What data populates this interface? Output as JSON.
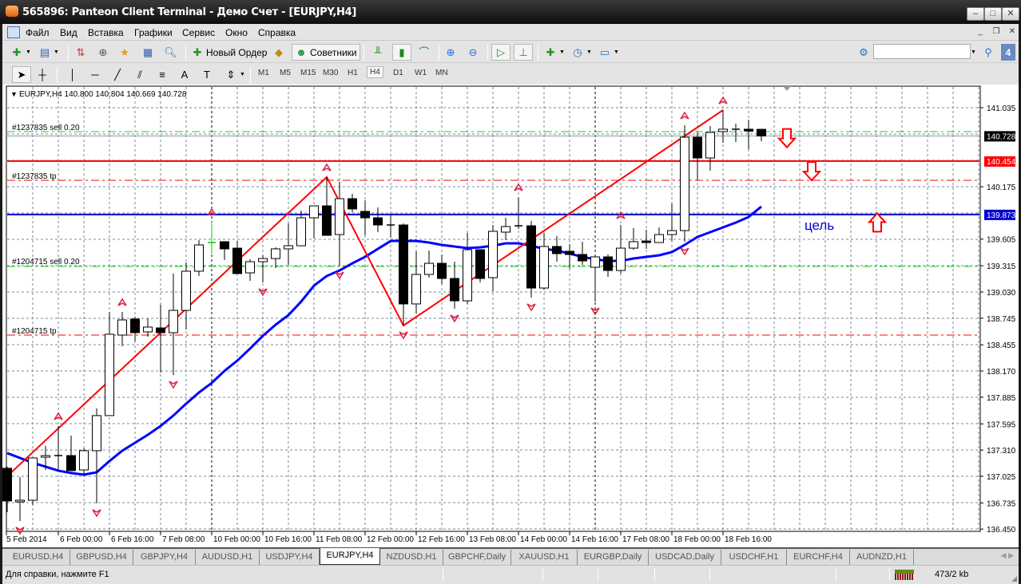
{
  "window": {
    "title": "565896: Panteon Client Terminal - Демо Счет - [EURJPY,H4]"
  },
  "menu": [
    "Файл",
    "Вид",
    "Вставка",
    "Графики",
    "Сервис",
    "Окно",
    "Справка"
  ],
  "toolbar": {
    "new_order_label": "Новый Ордер",
    "experts_label": "Советники",
    "search_value": "",
    "notification_count": "4",
    "timeframes": [
      "M1",
      "M5",
      "M15",
      "M30",
      "H1",
      "H4",
      "D1",
      "W1",
      "MN"
    ],
    "active_timeframe": "H4"
  },
  "chart": {
    "info": "EURJPY,H4  140.800 140.804 140.669 140.728",
    "order_labels": [
      "#1237835 sell 0.20",
      "#1237835 tp",
      "#1204715 sell 0.20",
      "#1204715 tp"
    ],
    "annotation": "цель",
    "price_tags": [
      {
        "value": "140.728",
        "bg": "#000000"
      },
      {
        "value": "140.454",
        "bg": "#ff0000"
      },
      {
        "value": "139.873",
        "bg": "#0000cc"
      }
    ]
  },
  "chart_data": {
    "type": "candlestick",
    "symbol": "EURJPY",
    "timeframe": "H4",
    "ylim": [
      136.435,
      141.252
    ],
    "grid": true,
    "price_axis_labels": [
      "141.035",
      "140.175",
      "139.605",
      "139.315",
      "139.030",
      "138.745",
      "138.455",
      "138.170",
      "137.885",
      "137.595",
      "137.310",
      "137.025",
      "136.735",
      "136.450"
    ],
    "time_axis_labels": [
      {
        "bar": 0,
        "text": "5 Feb 2014"
      },
      {
        "bar": 4,
        "text": "6 Feb 00:00"
      },
      {
        "bar": 8,
        "text": "6 Feb 16:00"
      },
      {
        "bar": 12,
        "text": "7 Feb 08:00"
      },
      {
        "bar": 16,
        "text": "10 Feb 00:00"
      },
      {
        "bar": 20,
        "text": "10 Feb 16:00"
      },
      {
        "bar": 24,
        "text": "11 Feb 08:00"
      },
      {
        "bar": 28,
        "text": "12 Feb 00:00"
      },
      {
        "bar": 32,
        "text": "12 Feb 16:00"
      },
      {
        "bar": 36,
        "text": "13 Feb 08:00"
      },
      {
        "bar": 40,
        "text": "14 Feb 00:00"
      },
      {
        "bar": 44,
        "text": "14 Feb 16:00"
      },
      {
        "bar": 48,
        "text": "17 Feb 08:00"
      },
      {
        "bar": 52,
        "text": "18 Feb 00:00"
      },
      {
        "bar": 56,
        "text": "18 Feb 16:00"
      }
    ],
    "ohlc": [
      [
        137.112,
        137.129,
        136.634,
        136.756
      ],
      [
        136.756,
        137.016,
        136.539,
        136.764
      ],
      [
        136.764,
        137.224,
        136.712,
        137.224
      ],
      [
        137.233,
        137.355,
        137.094,
        137.25
      ],
      [
        137.25,
        137.572,
        137.086,
        137.25
      ],
      [
        137.25,
        137.467,
        137.086,
        137.086
      ],
      [
        137.094,
        137.329,
        137.042,
        137.303
      ],
      [
        137.303,
        137.763,
        136.73,
        137.685
      ],
      [
        137.685,
        138.813,
        137.685,
        138.57
      ],
      [
        138.561,
        138.813,
        138.44,
        138.726
      ],
      [
        138.735,
        138.761,
        138.492,
        138.587
      ],
      [
        138.596,
        138.743,
        138.544,
        138.648
      ],
      [
        138.639,
        138.891,
        138.153,
        138.587
      ],
      [
        138.587,
        139.23,
        138.127,
        138.83
      ],
      [
        138.83,
        139.351,
        138.622,
        139.256
      ],
      [
        139.256,
        139.594,
        139.204,
        139.542
      ],
      [
        139.568,
        139.794,
        139.447,
        139.568
      ],
      [
        139.577,
        139.577,
        139.377,
        139.499
      ],
      [
        139.507,
        139.585,
        139.23,
        139.23
      ],
      [
        139.238,
        139.386,
        139.151,
        139.36
      ],
      [
        139.36,
        139.429,
        139.134,
        139.394
      ],
      [
        139.394,
        139.516,
        139.29,
        139.499
      ],
      [
        139.499,
        139.776,
        139.325,
        139.533
      ],
      [
        139.533,
        139.915,
        139.533,
        139.837
      ],
      [
        139.837,
        139.967,
        139.611,
        139.967
      ],
      [
        139.967,
        140.28,
        139.646,
        139.646
      ],
      [
        139.655,
        140.228,
        139.316,
        140.045
      ],
      [
        140.045,
        140.098,
        139.898,
        139.933
      ],
      [
        139.907,
        140.028,
        139.646,
        139.837
      ],
      [
        139.837,
        139.95,
        139.681,
        139.759
      ],
      [
        139.759,
        139.872,
        139.62,
        139.759
      ],
      [
        139.759,
        139.776,
        138.665,
        138.9
      ],
      [
        138.9,
        139.473,
        138.796,
        139.221
      ],
      [
        139.221,
        139.481,
        139.186,
        139.342
      ],
      [
        139.342,
        139.438,
        139.117,
        139.177
      ],
      [
        139.177,
        139.36,
        138.848,
        138.934
      ],
      [
        138.934,
        139.672,
        138.9,
        139.49
      ],
      [
        139.49,
        139.49,
        139.134,
        139.177
      ],
      [
        139.186,
        139.759,
        139.039,
        139.69
      ],
      [
        139.681,
        139.837,
        139.594,
        139.742
      ],
      [
        139.75,
        140.063,
        139.716,
        139.75
      ],
      [
        139.75,
        139.802,
        138.969,
        139.073
      ],
      [
        139.073,
        139.672,
        139.056,
        139.525
      ],
      [
        139.525,
        139.638,
        139.36,
        139.447
      ],
      [
        139.473,
        139.551,
        139.282,
        139.438
      ],
      [
        139.438,
        139.577,
        139.325,
        139.368
      ],
      [
        139.299,
        139.438,
        138.926,
        139.412
      ],
      [
        139.412,
        139.438,
        139.195,
        139.264
      ],
      [
        139.264,
        139.759,
        139.23,
        139.507
      ],
      [
        139.507,
        139.724,
        139.49,
        139.577
      ],
      [
        139.585,
        139.707,
        139.499,
        139.568
      ],
      [
        139.568,
        139.733,
        139.568,
        139.655
      ],
      [
        139.655,
        139.993,
        139.585,
        139.698
      ],
      [
        139.698,
        140.844,
        139.577,
        140.714
      ],
      [
        140.714,
        140.766,
        140.245,
        140.488
      ],
      [
        140.488,
        140.835,
        140.349,
        140.766
      ],
      [
        140.775,
        141.009,
        140.653,
        140.801
      ],
      [
        140.801,
        140.861,
        140.662,
        140.801
      ],
      [
        140.801,
        140.905,
        140.584,
        140.783
      ],
      [
        140.8,
        140.804,
        140.669,
        140.728
      ]
    ],
    "moving_average": [
      137.277,
      137.224,
      137.172,
      137.129,
      137.086,
      137.06,
      137.042,
      137.068,
      137.19,
      137.303,
      137.389,
      137.476,
      137.572,
      137.685,
      137.815,
      137.936,
      138.04,
      138.171,
      138.283,
      138.414,
      138.553,
      138.674,
      138.778,
      138.926,
      139.099,
      139.204,
      139.264,
      139.342,
      139.412,
      139.499,
      139.585,
      139.585,
      139.585,
      139.568,
      139.542,
      139.525,
      139.507,
      139.516,
      139.533,
      139.559,
      139.559,
      139.533,
      139.499,
      139.481,
      139.447,
      139.412,
      139.386,
      139.368,
      139.368,
      139.394,
      139.412,
      139.429,
      139.464,
      139.542,
      139.629,
      139.681,
      139.733,
      139.785,
      139.846,
      139.959
    ],
    "zigzag": [
      {
        "bar": 0,
        "price": 137.025
      },
      {
        "bar": 25,
        "price": 140.28
      },
      {
        "bar": 31,
        "price": 138.665
      },
      {
        "bar": 56,
        "price": 141.009
      }
    ],
    "fractals_up": [
      4,
      9,
      16,
      25,
      40,
      48,
      53,
      56
    ],
    "fractals_down": [
      1,
      7,
      13,
      20,
      26,
      31,
      35,
      41,
      46,
      53
    ],
    "horizontal_lines": [
      {
        "price": 140.775,
        "style": "dashdot",
        "color": "#22cc22",
        "label": "#1237835 sell 0.20"
      },
      {
        "price": 140.728,
        "style": "solid",
        "color": "#8899aa"
      },
      {
        "price": 140.454,
        "style": "solid",
        "color": "#ff0000"
      },
      {
        "price": 140.245,
        "style": "dashdot",
        "color": "#ff0000",
        "label": "#1237835 tp"
      },
      {
        "price": 139.873,
        "style": "solid",
        "color": "#0000cc"
      },
      {
        "price": 139.308,
        "style": "dashdot",
        "color": "#22cc22",
        "label": "#1204715 sell 0.20"
      },
      {
        "price": 138.561,
        "style": "dashdot",
        "color": "#ff0000",
        "label": "#1204715 tp"
      }
    ],
    "vertical_lines_bars": [
      16,
      46
    ],
    "arrows": [
      {
        "direction": "down",
        "price": 140.7
      },
      {
        "direction": "down",
        "price": 140.34
      },
      {
        "direction": "up",
        "price": 139.79
      }
    ]
  },
  "tabs": [
    "EURUSD,H4",
    "GBPUSD,H4",
    "GBPJPY,H4",
    "AUDUSD,H1",
    "USDJPY,H4",
    "EURJPY,H4",
    "NZDUSD,H1",
    "GBPCHF,Daily",
    "XAUUSD,H1",
    "EURGBP,Daily",
    "USDCAD,Daily",
    "USDCHF,H1",
    "EURCHF,H4",
    "AUDNZD,H1"
  ],
  "active_tab": "EURJPY,H4",
  "status": {
    "help": "Для справки, нажмите F1",
    "traffic": "473/2 kb"
  },
  "colors": {
    "up_candle": "#ffffff",
    "down_candle": "#000000",
    "ma": "#0000ff",
    "zigzag": "#ff0000",
    "fractal": "#dd2244",
    "grid": "#778899"
  }
}
